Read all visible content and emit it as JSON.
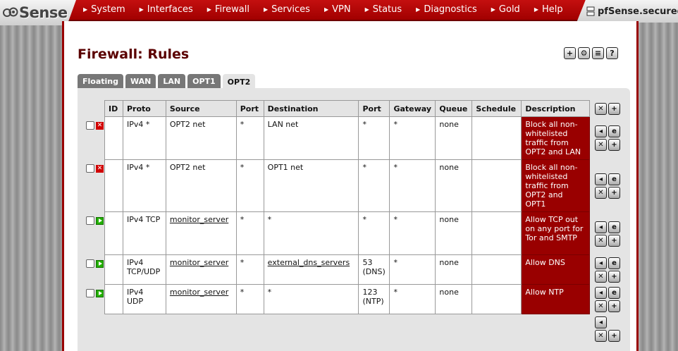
{
  "header": {
    "logo_text": "Sense",
    "hostname": "pfSense.secured",
    "nav": [
      "System",
      "Interfaces",
      "Firewall",
      "Services",
      "VPN",
      "Status",
      "Diagnostics",
      "Gold",
      "Help"
    ]
  },
  "page": {
    "title": "Firewall: Rules",
    "tabs": [
      "Floating",
      "WAN",
      "LAN",
      "OPT1",
      "OPT2"
    ],
    "active_tab": "OPT2"
  },
  "table": {
    "columns": [
      "ID",
      "Proto",
      "Source",
      "Port",
      "Destination",
      "Port",
      "Gateway",
      "Queue",
      "Schedule",
      "Description"
    ],
    "rows": [
      {
        "action": "block",
        "id": "",
        "proto": "IPv4 *",
        "source": "OPT2 net",
        "sport": "*",
        "destination": "LAN net",
        "dport": "*",
        "gateway": "*",
        "queue": "none",
        "schedule": "",
        "description": "Block all non-whitelisted traffic from OPT2 and LAN"
      },
      {
        "action": "block",
        "id": "",
        "proto": "IPv4 *",
        "source": "OPT2 net",
        "sport": "*",
        "destination": "OPT1 net",
        "dport": "*",
        "gateway": "*",
        "queue": "none",
        "schedule": "",
        "description": "Block all non-whitelisted traffic from OPT2 and OPT1"
      },
      {
        "action": "pass",
        "id": "",
        "proto": "IPv4 TCP",
        "source": "monitor_server",
        "sport": "*",
        "destination": "*",
        "dport": "*",
        "gateway": "*",
        "queue": "none",
        "schedule": "",
        "description": "Allow TCP out on any port for Tor and SMTP"
      },
      {
        "action": "pass",
        "id": "",
        "proto": "IPv4 TCP/UDP",
        "source": "monitor_server",
        "sport": "*",
        "destination": "external_dns_servers",
        "dport": "53 (DNS)",
        "gateway": "*",
        "queue": "none",
        "schedule": "",
        "description": "Allow DNS"
      },
      {
        "action": "pass",
        "id": "",
        "proto": "IPv4 UDP",
        "source": "monitor_server",
        "sport": "*",
        "destination": "*",
        "dport": "123 (NTP)",
        "gateway": "*",
        "queue": "none",
        "schedule": "",
        "description": "Allow NTP"
      }
    ]
  },
  "icons": {
    "top": [
      "add-rule-icon",
      "settings-icon",
      "log-icon",
      "help-icon"
    ],
    "row_actions": [
      "move-icon",
      "edit-icon",
      "delete-icon",
      "add-icon"
    ]
  },
  "colors": {
    "accent": "#990000",
    "block": "#d10000",
    "pass": "#23b000"
  }
}
